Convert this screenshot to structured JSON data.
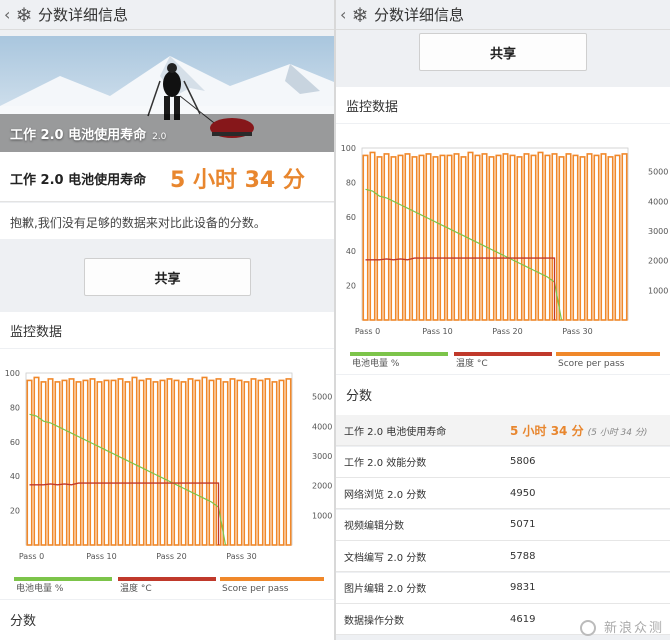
{
  "header": {
    "title": "分数详细信息",
    "back_glyph": "‹",
    "icon": "snowflake-icon"
  },
  "left": {
    "hero_title": "工作 2.0 电池使用寿命",
    "hero_sub": "2.0",
    "result_label": "工作 2.0 电池使用寿命",
    "result_value": "5 小时 34 分",
    "note": "抱歉,我们没有足够的数据来对比此设备的分数。",
    "share": "共享",
    "monitor_title": "监控数据",
    "score_title": "分数"
  },
  "right": {
    "share": "共享",
    "monitor_title": "监控数据",
    "score_title": "分数",
    "rows": [
      {
        "label": "工作 2.0 电池使用寿命",
        "value": "5 小时 34 分",
        "note": "(5 小时 34 分)"
      },
      {
        "label": "工作 2.0 效能分数",
        "value": "5806"
      },
      {
        "label": "网络浏览 2.0 分数",
        "value": "4950"
      },
      {
        "label": "视频编辑分数",
        "value": "5071"
      },
      {
        "label": "文档编写 2.0 分数",
        "value": "5788"
      },
      {
        "label": "图片编辑 2.0 分数",
        "value": "9831"
      },
      {
        "label": "数据操作分数",
        "value": "4619"
      }
    ]
  },
  "legend": [
    "电池电量 %",
    "温度 °C",
    "Score per pass"
  ],
  "colors": {
    "battery": "#7cc44a",
    "temp": "#c0392b",
    "score": "#f0882a",
    "accent": "#e8862e"
  },
  "chart_data": {
    "type": "bar",
    "x_tick_labels": [
      "Pass 0",
      "Pass 10",
      "Pass 20",
      "Pass 30"
    ],
    "x_ticks": [
      0,
      10,
      20,
      30
    ],
    "left_axis": {
      "ticks": [
        20,
        40,
        60,
        80,
        100
      ],
      "range": [
        0,
        100
      ]
    },
    "right_axis": {
      "ticks": [
        1000,
        2000,
        3000,
        4000,
        5000
      ],
      "range": [
        0,
        5800
      ]
    },
    "passes": 38,
    "series": [
      {
        "name": "Score per pass",
        "axis": "right",
        "values": [
          5550,
          5650,
          5500,
          5600,
          5500,
          5550,
          5600,
          5500,
          5550,
          5600,
          5500,
          5550,
          5550,
          5600,
          5500,
          5650,
          5550,
          5600,
          5500,
          5550,
          5600,
          5550,
          5500,
          5600,
          5550,
          5650,
          5550,
          5600,
          5500,
          5600,
          5550,
          5500,
          5600,
          5550,
          5600,
          5500,
          5550,
          5600
        ]
      },
      {
        "name": "电池电量 %",
        "axis": "left",
        "values": [
          76,
          75,
          72,
          71,
          69,
          67,
          65,
          63,
          61,
          59,
          57,
          55,
          53,
          51,
          49,
          47,
          45,
          43,
          41,
          39,
          37,
          35,
          33,
          31,
          29,
          27,
          25,
          22,
          0,
          0,
          0,
          0,
          0,
          0,
          0,
          0,
          0,
          0
        ]
      },
      {
        "name": "温度 °C",
        "axis": "left",
        "values": [
          35,
          35,
          35,
          35.5,
          35,
          35.5,
          35,
          36,
          36,
          36,
          36,
          36,
          36,
          36,
          36,
          36,
          36,
          36,
          36,
          36,
          36,
          36,
          36,
          36,
          36,
          36,
          36,
          36,
          0,
          0,
          0,
          0,
          0,
          0,
          0,
          0,
          0,
          0
        ]
      }
    ]
  },
  "watermark": "新浪众测"
}
